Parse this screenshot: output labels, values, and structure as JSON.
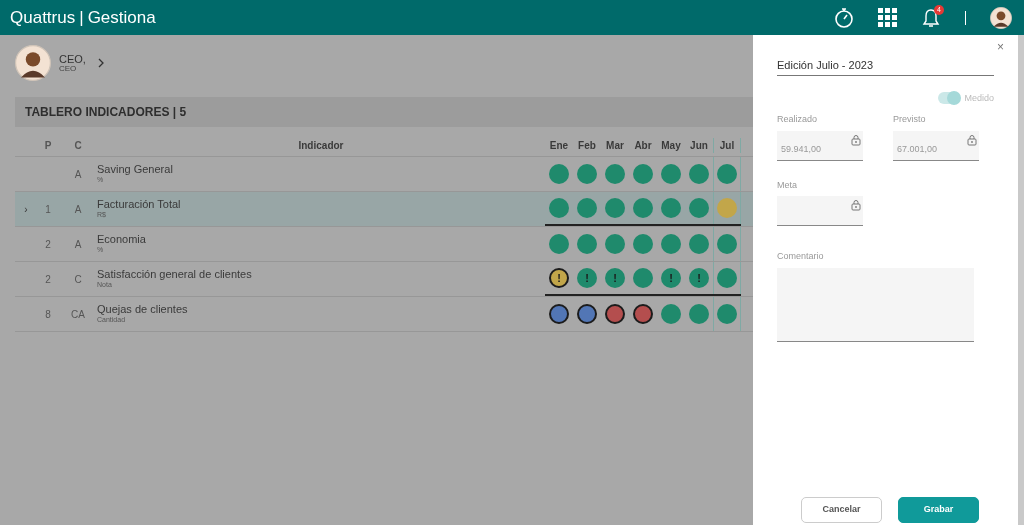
{
  "app": {
    "brand": "Quattrus",
    "separator": "|",
    "module": "Gestiona",
    "notification_count": "4"
  },
  "user": {
    "name": "CEO,",
    "role": "CEO"
  },
  "board": {
    "title": "TABLERO INDICADORES | 5"
  },
  "table": {
    "columns": [
      "P",
      "C",
      "Indicador"
    ],
    "months": [
      {
        "label": "Ene",
        "current": false
      },
      {
        "label": "Feb",
        "current": false
      },
      {
        "label": "Mar",
        "current": false
      },
      {
        "label": "Abr",
        "current": false
      },
      {
        "label": "May",
        "current": false
      },
      {
        "label": "Jun",
        "current": false
      },
      {
        "label": "Jul",
        "current": true
      }
    ],
    "rows": [
      {
        "c": "A",
        "name": "Saving General",
        "unit": "%",
        "selected": false,
        "underlined": false,
        "cells": [
          {
            "color": "#1f8a6c",
            "outlined": false
          },
          {
            "color": "#1f8a6c",
            "outlined": false
          },
          {
            "color": "#1f8a6c",
            "outlined": false
          },
          {
            "color": "#1f8a6c",
            "outlined": false
          },
          {
            "color": "#1f8a6c",
            "outlined": false
          },
          {
            "color": "#1f8a6c",
            "outlined": false
          },
          {
            "color": "#1f8a6c",
            "outlined": false
          }
        ]
      },
      {
        "expander": "›",
        "p": "1",
        "c": "A",
        "name": "Facturación Total",
        "unit": "R$",
        "selected": true,
        "underlined": true,
        "cells": [
          {
            "color": "#1f8a6c",
            "outlined": false
          },
          {
            "color": "#1f8a6c",
            "outlined": false
          },
          {
            "color": "#1f8a6c",
            "outlined": false
          },
          {
            "color": "#1f8a6c",
            "outlined": false
          },
          {
            "color": "#1f8a6c",
            "outlined": false
          },
          {
            "color": "#1f8a6c",
            "outlined": false
          },
          {
            "color": "#c2a64a",
            "outlined": false
          }
        ]
      },
      {
        "p": "2",
        "c": "A",
        "name": "Economia",
        "unit": "%",
        "selected": false,
        "underlined": false,
        "cells": [
          {
            "color": "#1f8a6c",
            "outlined": false
          },
          {
            "color": "#1f8a6c",
            "outlined": false
          },
          {
            "color": "#1f8a6c",
            "outlined": false
          },
          {
            "color": "#1f8a6c",
            "outlined": false
          },
          {
            "color": "#1f8a6c",
            "outlined": false
          },
          {
            "color": "#1f8a6c",
            "outlined": false
          },
          {
            "color": "#1f8a6c",
            "outlined": false
          }
        ]
      },
      {
        "p": "2",
        "c": "C",
        "name": "Satisfacción general de clientes",
        "unit": "Nota",
        "selected": false,
        "underlined": true,
        "cells": [
          {
            "color": "#c2a64a",
            "alert": "!",
            "outlined": true
          },
          {
            "color": "#1f8a6c",
            "alert": "!",
            "outlined": false
          },
          {
            "color": "#1f8a6c",
            "alert": "!",
            "outlined": false
          },
          {
            "color": "#1f8a6c",
            "outlined": false
          },
          {
            "color": "#1f8a6c",
            "alert": "!",
            "outlined": false
          },
          {
            "color": "#1f8a6c",
            "alert": "!",
            "outlined": false
          },
          {
            "color": "#1f8a6c",
            "outlined": false
          }
        ]
      },
      {
        "p": "8",
        "c": "CA",
        "name": "Quejas de clientes",
        "unit": "Cantidad",
        "selected": false,
        "underlined": false,
        "cells": [
          {
            "color": "#5276b5",
            "outlined": true
          },
          {
            "color": "#5276b5",
            "outlined": true
          },
          {
            "color": "#b44e4e",
            "outlined": true
          },
          {
            "color": "#b44e4e",
            "outlined": true
          },
          {
            "color": "#1f8a6c",
            "outlined": false
          },
          {
            "color": "#1f8a6c",
            "outlined": false
          },
          {
            "color": "#1f8a6c",
            "outlined": false
          }
        ]
      }
    ]
  },
  "panel": {
    "title": "Edición Julio - 2023",
    "close": "×",
    "measured": {
      "label": "Medido",
      "on": true,
      "disabled": true
    },
    "fields": [
      {
        "label": "Realizado",
        "value": "59.941,00",
        "locked": true
      },
      {
        "label": "Previsto",
        "value": "67.001,00",
        "locked": true
      },
      {
        "label": "Meta",
        "locked": true
      }
    ],
    "comment": {
      "label": "Comentario"
    },
    "buttons": [
      {
        "label": "Cancelar",
        "kind": "secondary"
      },
      {
        "label": "Grabar",
        "kind": "primary"
      }
    ]
  }
}
